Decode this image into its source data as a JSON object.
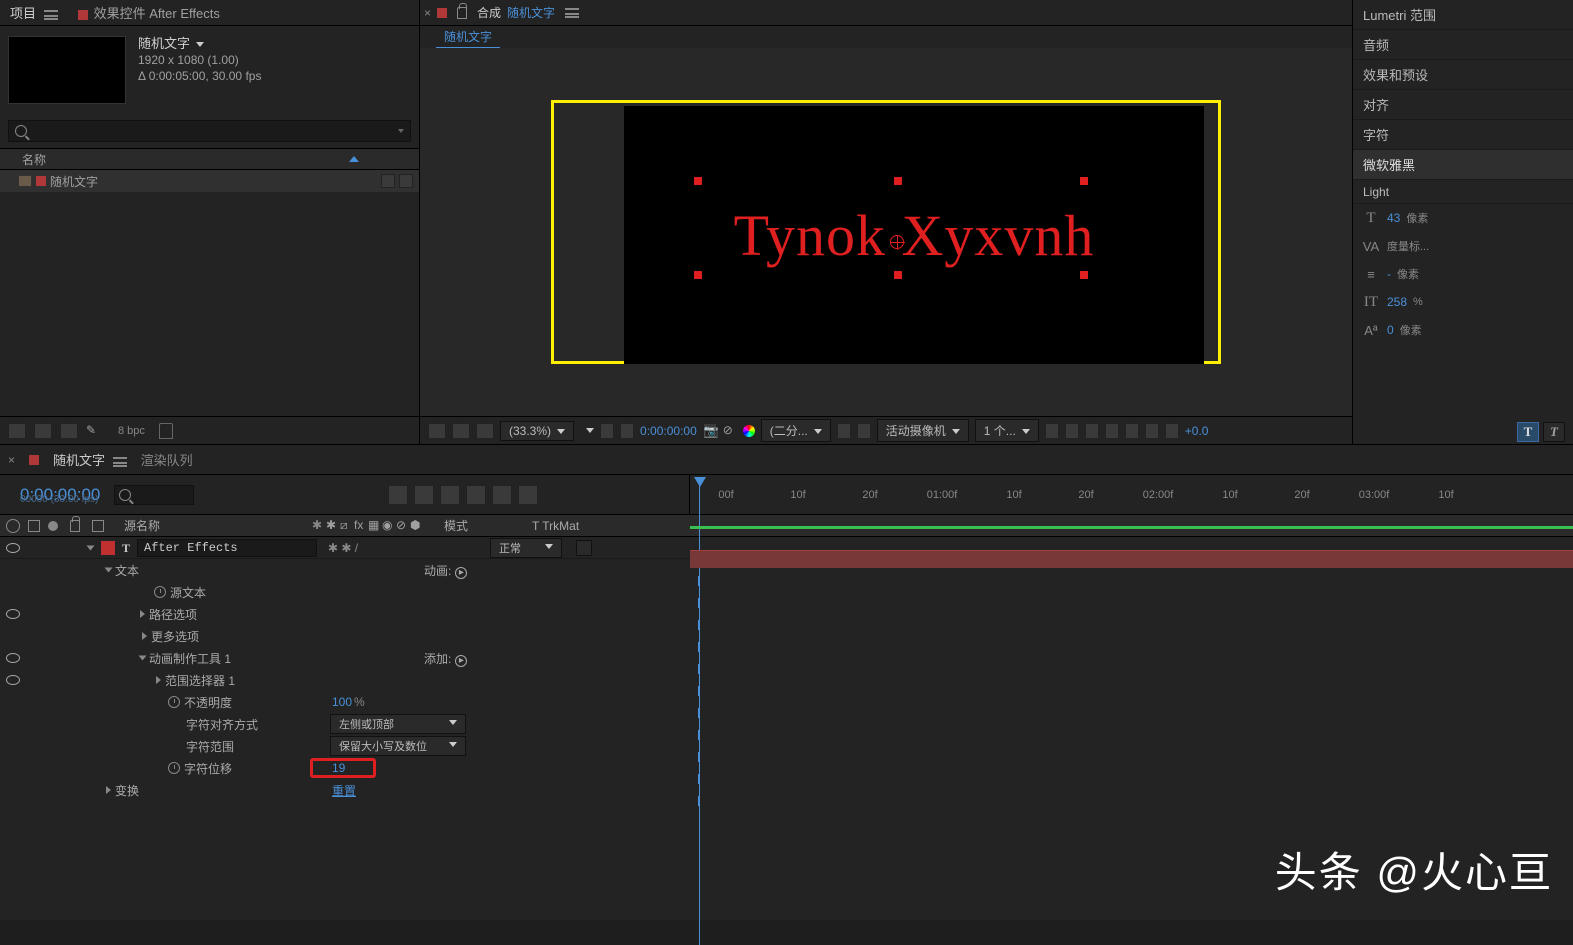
{
  "project": {
    "tab1": "项目",
    "tab2": "效果控件 After Effects",
    "comp_name": "随机文字",
    "dims": "1920 x 1080 (1.00)",
    "duration": "Δ 0:00:05:00, 30.00 fps",
    "search_ph": "",
    "col_name": "名称",
    "item1": "随机文字",
    "bpc": "8 bpc"
  },
  "comp": {
    "tab_label": "合成",
    "comp_name": "随机文字",
    "subtab": "随机文字",
    "preview_text": "Tynok Xyxvnh",
    "zoom": "(33.3%)",
    "timecode": "0:00:00:00",
    "res": "(二分...",
    "camera": "活动摄像机",
    "views": "1 个...",
    "exp": "+0.0"
  },
  "right": {
    "p1": "Lumetri 范围",
    "p2": "音频",
    "p3": "效果和预设",
    "p4": "对齐",
    "p5": "字符",
    "font": "微软雅黑",
    "style": "Light",
    "size_v": "43",
    "size_u": "像素",
    "kern": "度量标...",
    "lead_v": "-",
    "lead_u": "像素",
    "vscale_v": "258",
    "vscale_u": "%",
    "baseline_v": "0",
    "baseline_u": "像素"
  },
  "timeline": {
    "tab1": "随机文字",
    "tab2": "渲染队列",
    "timecode": "0:00:00:00",
    "fps": "00000 (30.00 fps)",
    "col_src": "源名称",
    "col_mode": "模式",
    "col_trk": "T  TrkMat",
    "layer_name": "After Effects",
    "mode_normal": "正常",
    "ruler": [
      "00f",
      "10f",
      "20f",
      "01:00f",
      "10f",
      "20f",
      "02:00f",
      "10f",
      "20f",
      "03:00f",
      "10f"
    ],
    "p_text": "文本",
    "p_animate": "动画:",
    "p_src": "源文本",
    "p_path": "路径选项",
    "p_more": "更多选项",
    "p_anim1": "动画制作工具 1",
    "p_add": "添加:",
    "p_range": "范围选择器 1",
    "p_opacity": "不透明度",
    "p_opacity_v": "100",
    "p_opacity_u": "%",
    "p_align": "字符对齐方式",
    "p_align_v": "左侧或顶部",
    "p_charrange": "字符范围",
    "p_charrange_v": "保留大小写及数位",
    "p_offset": "字符位移",
    "p_offset_v": "19",
    "p_transform": "变换",
    "p_reset": "重置"
  },
  "watermark": {
    "pre": "头条 ",
    "author": "@火心亘"
  }
}
